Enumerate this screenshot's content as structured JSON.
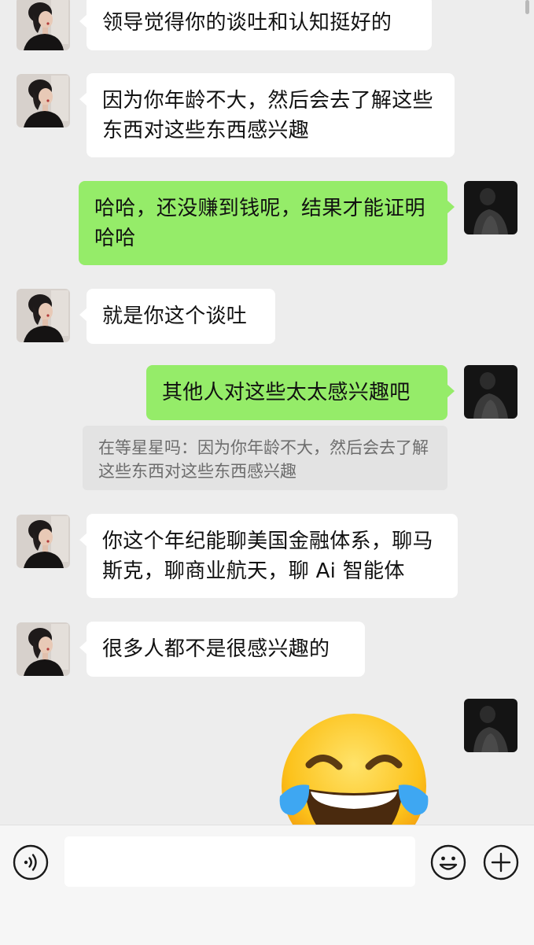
{
  "conversation": {
    "messages": [
      {
        "sender": "other",
        "text": "领导觉得你的谈吐和认知挺好的"
      },
      {
        "sender": "other",
        "text": "因为你年龄不大，然后会去了解这些东西对这些东西感兴趣"
      },
      {
        "sender": "me",
        "text": "哈哈，还没赚到钱呢，结果才能证明哈哈"
      },
      {
        "sender": "other",
        "text": "就是你这个谈吐"
      },
      {
        "sender": "me",
        "text": "其他人对这些太太感兴趣吧"
      },
      {
        "sender": "other",
        "text": "你这个年纪能聊美国金融体系，聊马斯克，聊商业航天，聊 Ai 智能体"
      },
      {
        "sender": "other",
        "text": "很多人都不是很感兴趣的"
      },
      {
        "sender": "me",
        "sticker": "tears-of-joy-emoji"
      }
    ],
    "quote": {
      "author": "在等星星吗",
      "separator": "：",
      "text": "因为你年龄不大，然后会去了解这些东西对这些东西感兴趣"
    }
  },
  "input_bar": {
    "message_value": "",
    "icons": [
      "voice-icon",
      "emoji-smile-icon",
      "plus-icon"
    ]
  },
  "colors": {
    "chat_background": "#ededed",
    "incoming_bubble": "#ffffff",
    "outgoing_bubble": "#95ec69",
    "quote_background": "#e3e3e3",
    "input_bar_background": "#f6f6f6"
  }
}
